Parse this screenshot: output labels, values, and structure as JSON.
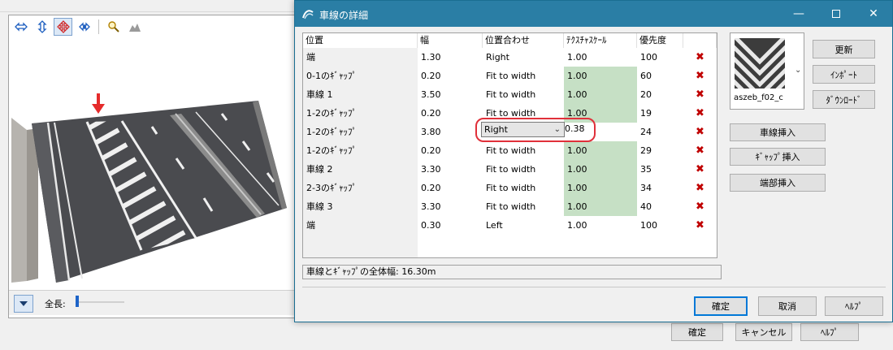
{
  "background": {
    "toolbar_icons": [
      "move-horizontal-icon",
      "move-vertical-icon",
      "move-all-icon",
      "rotate-icon",
      "zoom-icon",
      "mountain-icon"
    ],
    "length_label": "全長:",
    "buttons": {
      "ok": "確定",
      "cancel": "キャンセル",
      "help": "ﾍﾙﾌﾟ"
    }
  },
  "dialog": {
    "title": "車線の詳細",
    "columns": {
      "position": "位置",
      "width": "幅",
      "alignment": "位置合わせ",
      "texture_scale": "ﾃｸｽﾁｬｽｹｰﾙ",
      "priority": "優先度"
    },
    "rows": [
      {
        "name": "端",
        "width": "1.30",
        "alignment": "Right",
        "texture_scale": "1.00",
        "priority": "100",
        "green": false
      },
      {
        "name": "0-1のｷﾞｬｯﾌﾟ",
        "width": "0.20",
        "alignment": "Fit to width",
        "texture_scale": "1.00",
        "priority": "60",
        "green": true
      },
      {
        "name": "車線 1",
        "width": "3.50",
        "alignment": "Fit to width",
        "texture_scale": "1.00",
        "priority": "20",
        "green": true
      },
      {
        "name": "1-2のｷﾞｬｯﾌﾟ",
        "width": "0.20",
        "alignment": "Fit to width",
        "texture_scale": "1.00",
        "priority": "19",
        "green": true
      },
      {
        "name": "1-2のｷﾞｬｯﾌﾟ",
        "width": "3.80",
        "alignment": "",
        "texture_scale": "",
        "priority": "24",
        "green": false
      },
      {
        "name": "1-2のｷﾞｬｯﾌﾟ",
        "width": "0.20",
        "alignment": "Fit to width",
        "texture_scale": "1.00",
        "priority": "29",
        "green": true
      },
      {
        "name": "車線 2",
        "width": "3.30",
        "alignment": "Fit to width",
        "texture_scale": "1.00",
        "priority": "35",
        "green": true
      },
      {
        "name": "2-3のｷﾞｬｯﾌﾟ",
        "width": "0.20",
        "alignment": "Fit to width",
        "texture_scale": "1.00",
        "priority": "34",
        "green": true
      },
      {
        "name": "車線 3",
        "width": "3.30",
        "alignment": "Fit to width",
        "texture_scale": "1.00",
        "priority": "40",
        "green": true
      },
      {
        "name": "端",
        "width": "0.30",
        "alignment": "Left",
        "texture_scale": "1.00",
        "priority": "100",
        "green": false
      }
    ],
    "editing": {
      "select_value": "Right",
      "texture_value": "0.38"
    },
    "total_width": "車線とｷﾞｬｯﾌﾟの全体幅: 16.30m",
    "texture_name": "aszeb_f02_c",
    "side_buttons": {
      "update": "更新",
      "import": "ｲﾝﾎﾟｰﾄ",
      "download": "ﾀﾞｳﾝﾛｰﾄﾞ"
    },
    "insert_buttons": {
      "lane": "車線挿入",
      "gap": "ｷﾞｬｯﾌﾟ挿入",
      "edge": "端部挿入"
    },
    "footer_buttons": {
      "ok": "確定",
      "cancel": "取消",
      "help": "ﾍﾙﾌﾟ"
    },
    "green_color": "#c6e0c5",
    "title_color": "#2a7ea5"
  }
}
